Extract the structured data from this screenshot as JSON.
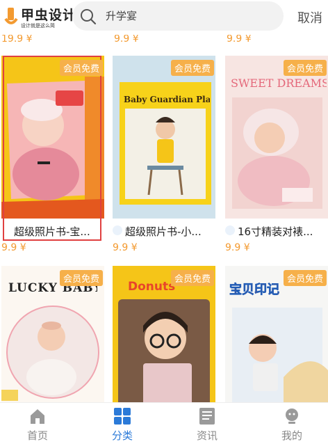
{
  "header": {
    "logo_text": "甲虫设计",
    "logo_sub": "设计就是这么简",
    "search_value": "升学宴",
    "cancel_label": "取消"
  },
  "top_prices": [
    "19.9 ¥",
    "9.9 ¥",
    "9.9 ¥"
  ],
  "badge_label": "会员免费",
  "cards": [
    {
      "title": "超级照片书-宝...",
      "price": "9.9 ¥",
      "art_text": ""
    },
    {
      "title": "超级照片书-小...",
      "price": "9.9 ¥",
      "art_text": "Baby Guardian Plan"
    },
    {
      "title": "16寸精装对裱...",
      "price": "9.9 ¥",
      "art_text": "SWEET DREAMS"
    },
    {
      "title": "",
      "price": "",
      "art_text": "LUCKY BABY"
    },
    {
      "title": "",
      "price": "",
      "art_text": "Donuts"
    },
    {
      "title": "",
      "price": "",
      "art_text": ""
    }
  ],
  "nav": {
    "items": [
      {
        "label": "首页",
        "icon": "home-icon"
      },
      {
        "label": "分类",
        "icon": "grid-icon"
      },
      {
        "label": "资讯",
        "icon": "news-icon"
      },
      {
        "label": "我的",
        "icon": "profile-icon"
      }
    ],
    "active_index": 1,
    "active_color": "#2b7ad8"
  },
  "colors": {
    "price": "#f39a30",
    "badge": "#f6b04a",
    "selection": "#e04040"
  }
}
